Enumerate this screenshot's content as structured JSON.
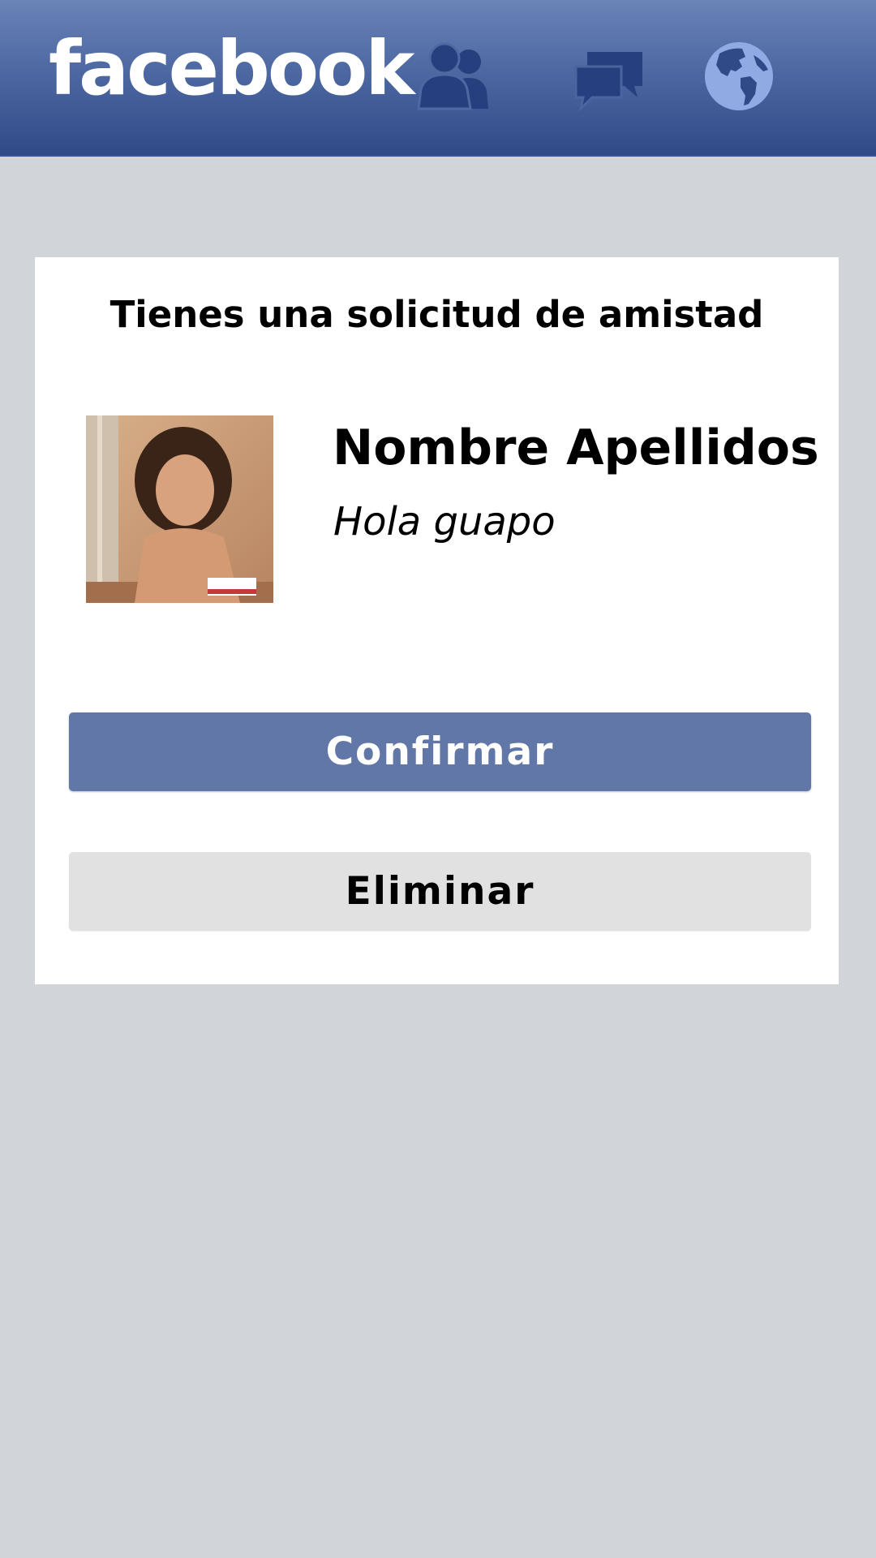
{
  "header": {
    "logo_text": "facebook",
    "nav_icons": [
      "friends-icon",
      "messages-icon",
      "globe-icon"
    ]
  },
  "request": {
    "title": "Tienes una solicitud de amistad",
    "name": "Nombre Apellidos",
    "message": "Hola guapo",
    "confirm_label": "Confirmar",
    "delete_label": "Eliminar"
  },
  "colors": {
    "header_top": "#6a84b8",
    "header_bottom": "#2f4a87",
    "background": "#d1d4d9",
    "confirm_button": "#6077a8",
    "delete_button": "#e1e1e1",
    "nav_icon_dark": "#263f7e",
    "nav_icon_light": "#90abe3"
  }
}
